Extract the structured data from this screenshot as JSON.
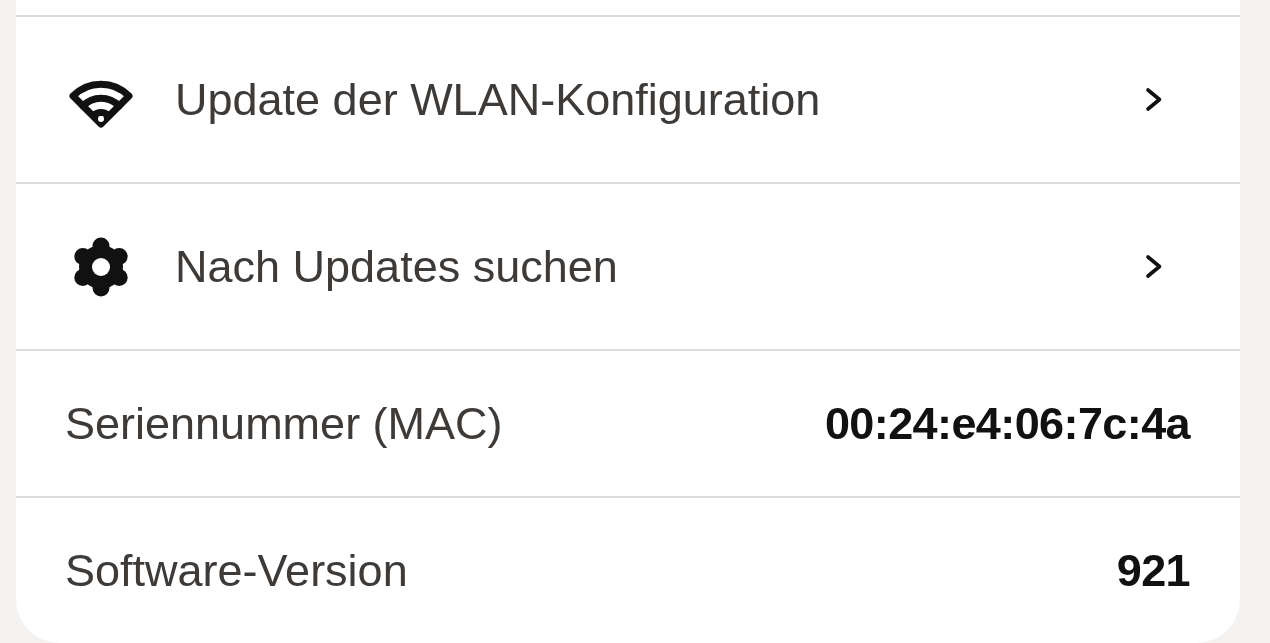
{
  "settings_list": {
    "rows": [
      {
        "kind": "link",
        "label": "Update der WLAN-Konfiguration"
      },
      {
        "kind": "link",
        "label": "Nach Updates suchen"
      },
      {
        "kind": "info",
        "label": "Seriennummer (MAC)",
        "value": "00:24:e4:06:7c:4a"
      },
      {
        "kind": "info",
        "label": "Software-Version",
        "value": "921"
      }
    ]
  }
}
